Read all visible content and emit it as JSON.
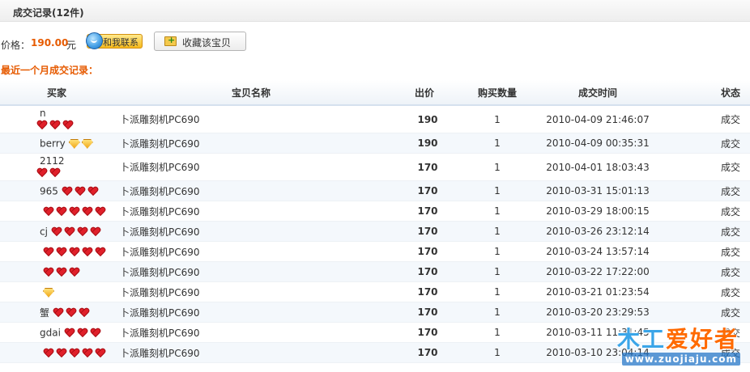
{
  "header": {
    "title": "成交记录(12件)"
  },
  "price": {
    "label": "价格：",
    "value": "190.00",
    "unit": "元"
  },
  "buttons": {
    "contact_label": "和我联系",
    "favorite_label": "收藏该宝贝"
  },
  "section_title": "最近一个月成交记录：",
  "table": {
    "columns": {
      "buyer": "买家",
      "item": "宝贝名称",
      "price": "出价",
      "qty": "购买数量",
      "time": "成交时间",
      "status": "状态"
    },
    "rows": [
      {
        "buyer": "n",
        "badges": [
          "heart",
          "heart",
          "heart"
        ],
        "tall": true,
        "item": "卜派雕刻机PC690",
        "price": "190",
        "qty": "1",
        "time": "2010-04-09 21:46:07",
        "status": "成交"
      },
      {
        "buyer": "berry",
        "badges": [
          "diamond",
          "diamond"
        ],
        "tall": false,
        "item": "卜派雕刻机PC690",
        "price": "190",
        "qty": "1",
        "time": "2010-04-09 00:35:31",
        "status": "成交"
      },
      {
        "buyer": "2112",
        "badges": [
          "heart",
          "heart"
        ],
        "tall": true,
        "item": "卜派雕刻机PC690",
        "price": "170",
        "qty": "1",
        "time": "2010-04-01 18:03:43",
        "status": "成交"
      },
      {
        "buyer": "965",
        "badges": [
          "heart",
          "heart",
          "heart"
        ],
        "tall": false,
        "item": "卜派雕刻机PC690",
        "price": "170",
        "qty": "1",
        "time": "2010-03-31 15:01:13",
        "status": "成交"
      },
      {
        "buyer": "",
        "badges": [
          "heart",
          "heart",
          "heart",
          "heart",
          "heart"
        ],
        "tall": false,
        "item": "卜派雕刻机PC690",
        "price": "170",
        "qty": "1",
        "time": "2010-03-29 18:00:15",
        "status": "成交"
      },
      {
        "buyer": "cj",
        "badges": [
          "heart",
          "heart",
          "heart",
          "heart"
        ],
        "tall": false,
        "item": "卜派雕刻机PC690",
        "price": "170",
        "qty": "1",
        "time": "2010-03-26 23:12:14",
        "status": "成交"
      },
      {
        "buyer": "",
        "badges": [
          "heart",
          "heart",
          "heart",
          "heart",
          "heart"
        ],
        "tall": false,
        "item": "卜派雕刻机PC690",
        "price": "170",
        "qty": "1",
        "time": "2010-03-24 13:57:14",
        "status": "成交"
      },
      {
        "buyer": "",
        "badges": [
          "heart",
          "heart",
          "heart"
        ],
        "tall": false,
        "item": "卜派雕刻机PC690",
        "price": "170",
        "qty": "1",
        "time": "2010-03-22 17:22:00",
        "status": "成交"
      },
      {
        "buyer": "",
        "badges": [
          "diamond"
        ],
        "tall": false,
        "item": "卜派雕刻机PC690",
        "price": "170",
        "qty": "1",
        "time": "2010-03-21 01:23:54",
        "status": "成交"
      },
      {
        "buyer": "蟹",
        "badges": [
          "heart",
          "heart",
          "heart"
        ],
        "tall": false,
        "item": "卜派雕刻机PC690",
        "price": "170",
        "qty": "1",
        "time": "2010-03-20 23:29:53",
        "status": "成交"
      },
      {
        "buyer": "gdai",
        "badges": [
          "heart",
          "heart",
          "heart"
        ],
        "tall": false,
        "item": "卜派雕刻机PC690",
        "price": "170",
        "qty": "1",
        "time": "2010-03-11 11:31:45",
        "status": "成交"
      },
      {
        "buyer": "",
        "badges": [
          "heart",
          "heart",
          "heart",
          "heart",
          "heart"
        ],
        "tall": false,
        "item": "卜派雕刻机PC690",
        "price": "170",
        "qty": "1",
        "time": "2010-03-10 23:04:14",
        "status": "成交"
      }
    ]
  },
  "watermark": {
    "logo_a": "木工",
    "logo_b": "爱好者",
    "url": "www.zuojiaju.com"
  },
  "colors": {
    "accent": "#e65a00",
    "link": "#1f4b87",
    "heart": "#e0202a"
  }
}
